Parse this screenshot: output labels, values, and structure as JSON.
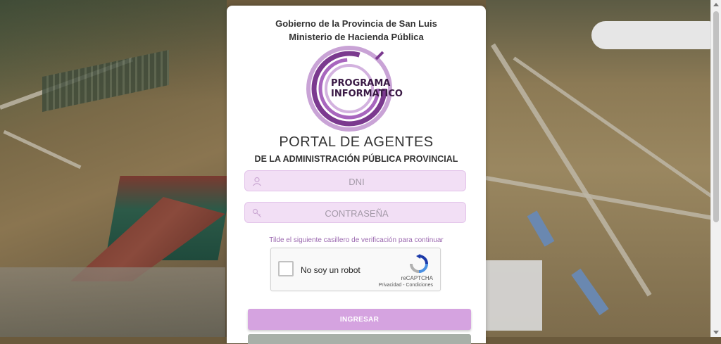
{
  "header": {
    "line1": "Gobierno de la Provincia de San Luis",
    "line2": "Ministerio de Hacienda Pública"
  },
  "logo": {
    "line1": "PROGRAMA",
    "line2": "INFORMATICO",
    "color": "#7b3a8f"
  },
  "portal": {
    "title": "PORTAL DE AGENTES",
    "subtitle": "DE LA ADMINISTRACIÓN PÚBLICA PROVINCIAL"
  },
  "form": {
    "dni_placeholder": "DNI",
    "password_placeholder": "CONTRASEÑA",
    "hint": "Tilde el siguiente casillero de verificación para continuar",
    "captcha_label": "No soy un robot",
    "captcha_brand": "reCAPTCHA",
    "captcha_links": "Privacidad - Condiciones",
    "submit_label": "INGRESAR"
  },
  "colors": {
    "field_bg": "#f2dff5",
    "button_bg": "#d5a3e0",
    "hint_color": "#9c6ab0"
  },
  "icons": {
    "dni_field_icon": "user-icon",
    "password_field_icon": "key-icon",
    "captcha_logo": "recaptcha-icon"
  }
}
